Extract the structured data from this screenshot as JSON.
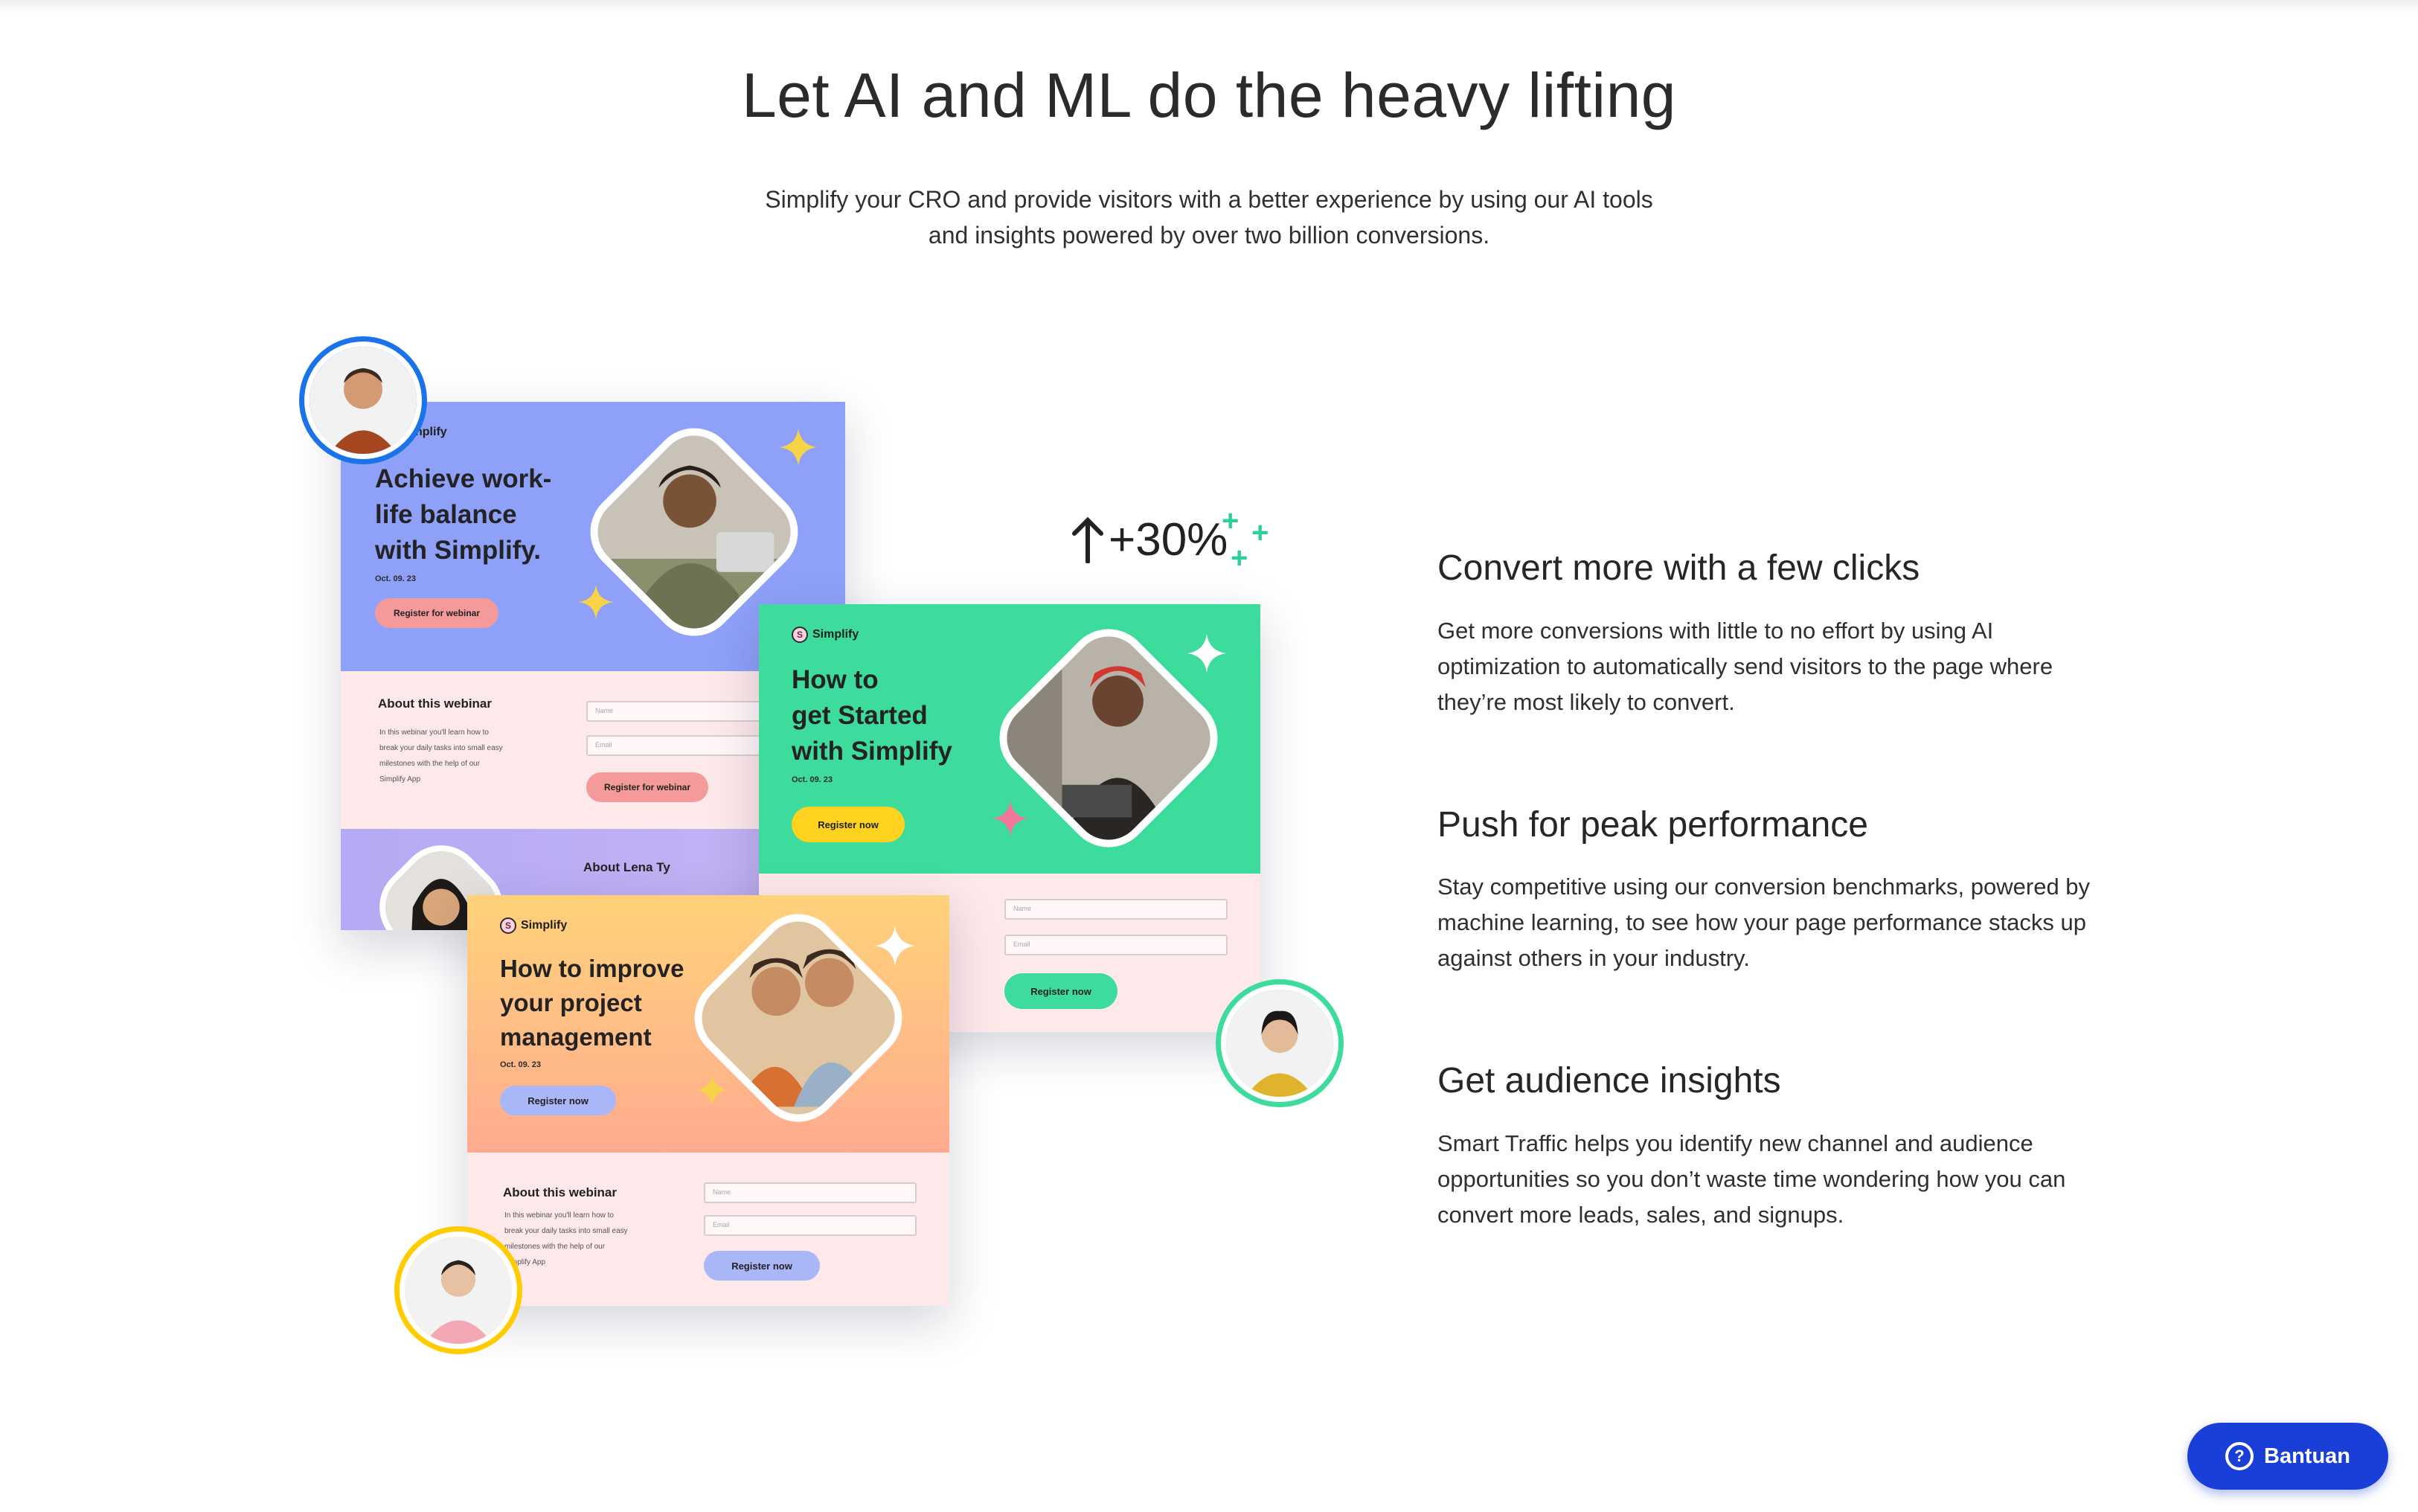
{
  "hero": {
    "title": "Let AI and ML do the heavy lifting",
    "subtitle_line1": "Simplify your CRO and provide visitors with a better experience by using our AI tools",
    "subtitle_line2": "and insights powered by over two billion conversions."
  },
  "mockups": {
    "brand": "Simplify",
    "brand_partial": "nplify",
    "uplift": "+30%",
    "card_purple": {
      "title_line1": "Achieve work-",
      "title_line2": "life balance",
      "title_line3": "with Simplify.",
      "date": "Oct. 09. 23",
      "cta": "Register for webinar",
      "section": "About this webinar",
      "body_line1": "In this webinar you'll learn how to",
      "body_line2": "break your daily tasks into small easy",
      "body_line3": "milestones with the help of our",
      "body_line4": "Simplify App",
      "name_placeholder": "Name",
      "email_placeholder": "Email",
      "form_cta": "Register for webinar",
      "about_person": "About Lena Ty",
      "colors": {
        "top": "#8ea0f8",
        "bottom": "#fde8ea",
        "button": "#f49a9a"
      }
    },
    "card_green": {
      "title_line1": "How to",
      "title_line2": "get Started",
      "title_line3": "with Simplify",
      "date": "Oct. 09. 23",
      "cta": "Register now",
      "name_placeholder": "Name",
      "email_placeholder": "Email",
      "form_cta": "Register now",
      "colors": {
        "top": "#3ddc9c",
        "bottom": "#fde8ea",
        "button": "#ffd21f"
      }
    },
    "card_orange": {
      "title_line1": "How to improve",
      "title_line2": "your project",
      "title_line3": "management",
      "date": "Oct. 09. 23",
      "cta": "Register now",
      "section": "About this webinar",
      "body_line1": "In this webinar you'll learn how to",
      "body_line2": "break your daily tasks into small easy",
      "body_line3": "milestones with the help of our",
      "body_line4": "Simplify App",
      "name_placeholder": "Name",
      "email_placeholder": "Email",
      "form_cta": "Register now",
      "colors": {
        "top_start": "#ffd27a",
        "top_end": "#ffab8f",
        "bottom": "#fde8ea",
        "button": "#a9b6f7"
      }
    }
  },
  "features": [
    {
      "title": "Convert more with a few clicks",
      "line1": "Get more conversions with little to no effort by using AI",
      "line2": "optimization to automatically send visitors to the page where",
      "line3": "they’re most likely to convert."
    },
    {
      "title": "Push for peak performance",
      "line1": "Stay competitive using our conversion benchmarks, powered by",
      "line2": "machine learning, to see how your page performance stacks up",
      "line3": "against others in your industry."
    },
    {
      "title": "Get audience insights",
      "line1": "Smart Traffic helps you identify new channel and audience",
      "line2": "opportunities so you don’t waste time wondering how you can",
      "line3": "convert more leads, sales, and signups."
    }
  ],
  "help": {
    "label": "Bantuan",
    "icon": "question-icon",
    "color": "#1a3fd9"
  },
  "avatars": [
    {
      "icon": "man-brown-shirt-avatar",
      "ring": "#1a73e8"
    },
    {
      "icon": "woman-yellow-jacket-avatar",
      "ring": "#3ddc9c"
    },
    {
      "icon": "person-pink-shirt-avatar",
      "ring": "#ffcc00"
    }
  ]
}
